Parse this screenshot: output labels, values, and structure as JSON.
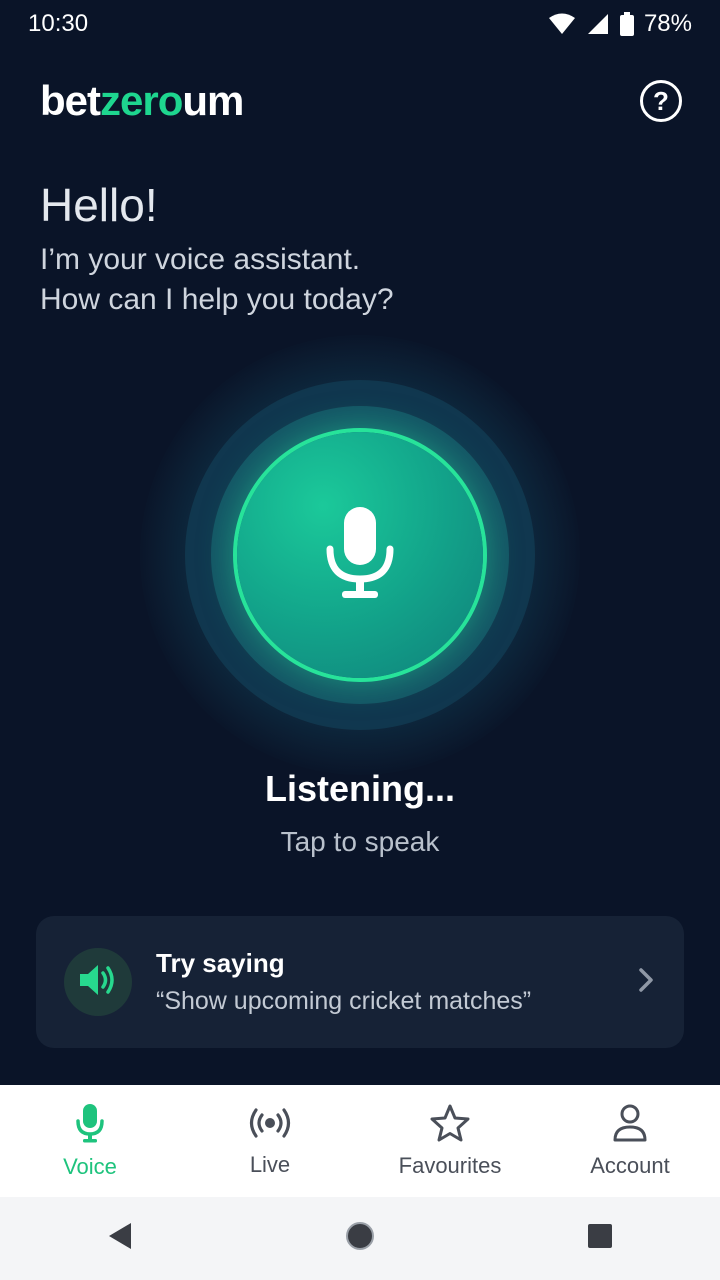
{
  "status_bar": {
    "time": "10:30",
    "battery": "78%"
  },
  "header": {
    "logo_part1": "bet",
    "logo_part2": "zero",
    "logo_part3": "um",
    "help_label": "?"
  },
  "greeting": {
    "title": "Hello!",
    "line1": "I’m your voice assistant.",
    "line2": "How can I help you today?"
  },
  "voice": {
    "status": "Listening...",
    "hint": "Tap to speak"
  },
  "suggestion": {
    "title": "Try saying",
    "example": "“Show upcoming cricket matches”",
    "icon": "speaker-icon"
  },
  "bottom_nav": {
    "items": [
      {
        "label": "Voice",
        "icon": "microphone-icon",
        "active": true
      },
      {
        "label": "Live",
        "icon": "live-broadcast-icon",
        "active": false
      },
      {
        "label": "Favourites",
        "icon": "star-icon",
        "active": false
      },
      {
        "label": "Account",
        "icon": "person-icon",
        "active": false
      }
    ]
  },
  "colors": {
    "background": "#0a1428",
    "accent": "#1ed68f",
    "card": "#162236",
    "nav_active": "#1ec37d"
  }
}
